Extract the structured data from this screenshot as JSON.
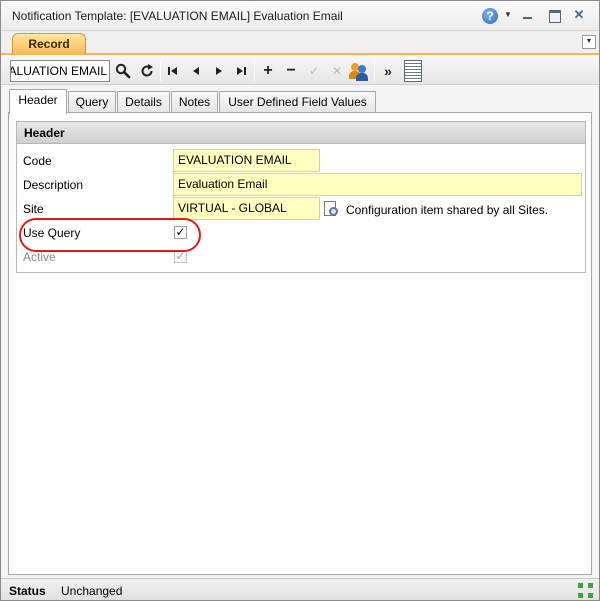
{
  "window": {
    "title": "Notification Template: [EVALUATION EMAIL] Evaluation Email"
  },
  "record_tab": {
    "label": "Record"
  },
  "toolbar": {
    "record_value": "EVALUATION EMAIL",
    "more_glyph": "»"
  },
  "tabs": [
    {
      "label": "Header",
      "active": true
    },
    {
      "label": "Query",
      "active": false
    },
    {
      "label": "Details",
      "active": false
    },
    {
      "label": "Notes",
      "active": false
    },
    {
      "label": "User Defined Field Values",
      "active": false
    }
  ],
  "header_section": {
    "title": "Header",
    "code_label": "Code",
    "code_value": "EVALUATION EMAIL",
    "description_label": "Description",
    "description_value": "Evaluation Email",
    "site_label": "Site",
    "site_value": "VIRTUAL - GLOBAL",
    "site_note": "Configuration item shared by all Sites.",
    "use_query_label": "Use Query",
    "use_query_checked": true,
    "active_label": "Active",
    "active_checked": true
  },
  "status": {
    "label": "Status",
    "value": "Unchanged"
  },
  "colors": {
    "required_field_bg": "#ffffbf",
    "record_tab_accent": "#f7b84f",
    "highlight_ring": "#d81e1e"
  }
}
